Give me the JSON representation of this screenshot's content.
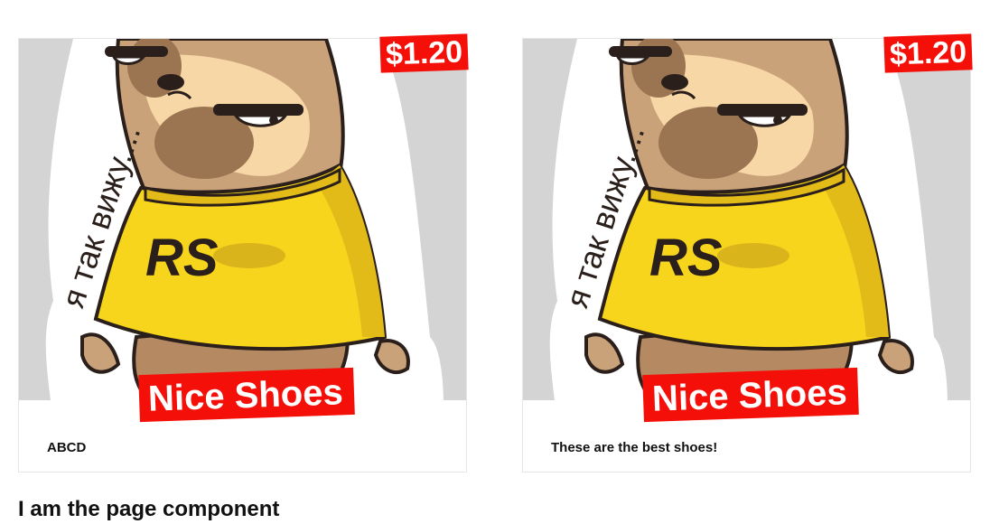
{
  "cards": [
    {
      "price": "$1.20",
      "title": "Nice Shoes",
      "description": "ABCD",
      "image_shirt_text": "RS",
      "image_caption_text": "я так вижу...."
    },
    {
      "price": "$1.20",
      "title": "Nice Shoes",
      "description": "These are the best shoes!",
      "image_shirt_text": "RS",
      "image_caption_text": "я так вижу...."
    }
  ],
  "page": {
    "heading": "I am the page component"
  },
  "colors": {
    "tag_red": "#f40f08",
    "media_bg": "#d4d4d4",
    "shirt_yellow": "#f7d51d",
    "fur_brown": "#c9a27a"
  },
  "icons": [
    "sloth-sticker-image"
  ]
}
